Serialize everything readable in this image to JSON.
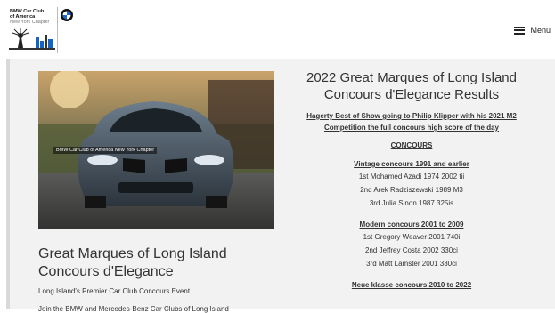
{
  "header": {
    "logo_line1": "BMW Car Club",
    "logo_line2": "of America",
    "logo_line3": "New York Chapter",
    "menu_label": "Menu"
  },
  "photo": {
    "caption": "BMW Car Club of America New York Chapter"
  },
  "left": {
    "title": "Great Marques of Long Island Concours d'Elegance",
    "subtitle": "Long Island's Premier Car Club Concours Event",
    "partial_text": "Join the BMW and Mercedes-Benz Car Clubs of Long Island"
  },
  "right": {
    "title": "2022 Great Marques of Long Island Concours d'Elegance Results",
    "highlight": "Hagerty Best of Show going to Philip Klipper with his 2021 M2 Competition the full concours high score of the day",
    "concours_heading": "CONCOURS",
    "sections": [
      {
        "heading": "Vintage concours   1991 and earlier",
        "items": [
          "1st Mohamed Azadi 1974 2002 tii",
          "2nd Arek Radziszewski 1989 M3",
          "3rd Julia Sinon 1987 325is"
        ]
      },
      {
        "heading": "Modern  concours 2001 to 2009",
        "items": [
          "1st Gregory Weaver 2001 740i",
          "2nd Jeffrey Costa 2002 330ci",
          "3rd Matt Lamster 2001 330ci"
        ]
      },
      {
        "heading": "Neue klasse concours 2010 to 2022",
        "items": []
      }
    ]
  }
}
